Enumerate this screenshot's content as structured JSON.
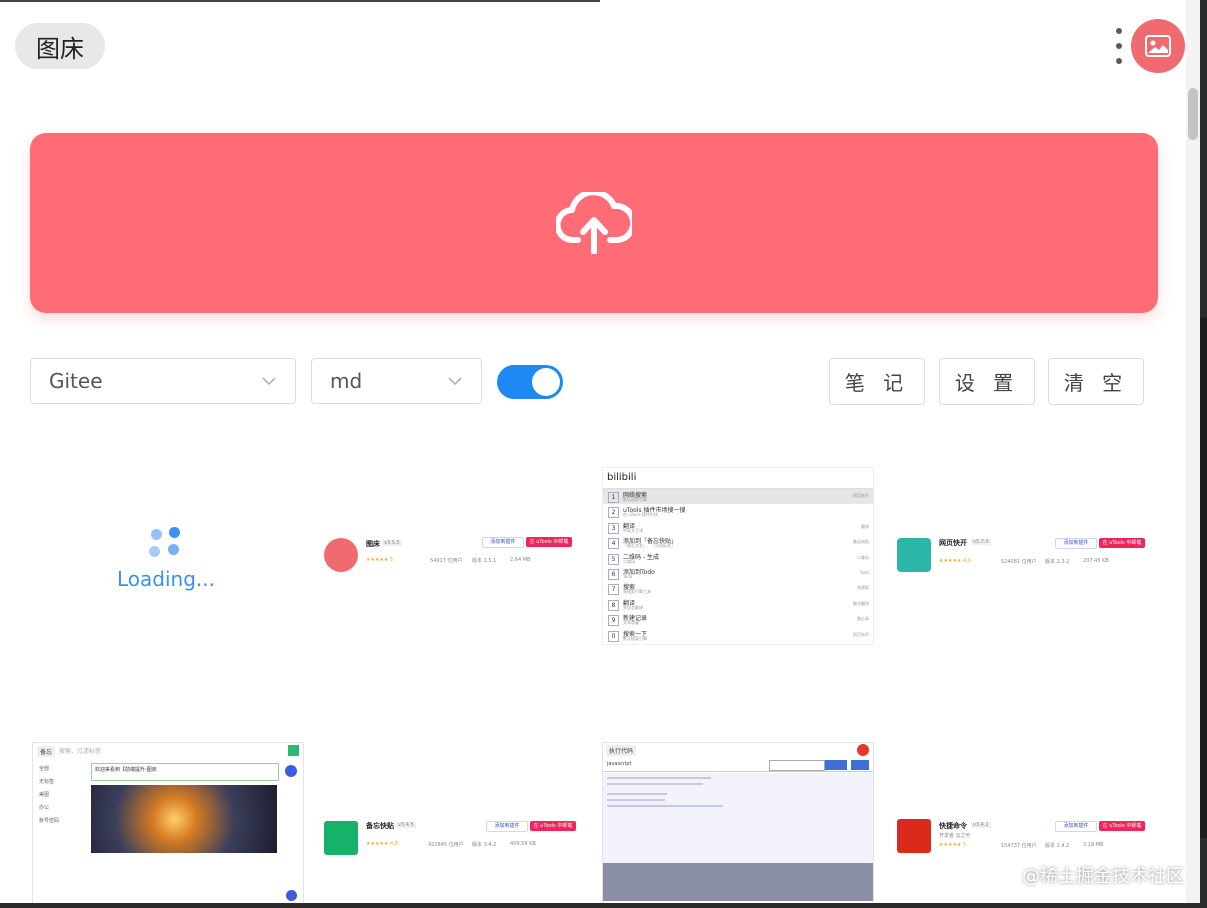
{
  "app": {
    "title": "图床"
  },
  "header": {
    "more_icon": "more-vertical-icon",
    "avatar_icon": "image-icon",
    "avatar_color": "#ef6b6f"
  },
  "upload": {
    "icon": "cloud-upload-icon",
    "color": "#ff6c76"
  },
  "toolbar": {
    "host_select": "Gitee",
    "format_select": "md",
    "toggle_on": true,
    "buttons": [
      "笔 记",
      "设 置",
      "清 空"
    ]
  },
  "loading": {
    "text": "Loading..."
  },
  "gallery": {
    "plugin1": {
      "name": "图床",
      "version": "v3.5.5",
      "rating": "5",
      "users": "54917 位用户",
      "ver_label": "版本 1.5.1",
      "size": "2.64 MB",
      "btn_installed": "添加到插件",
      "btn_uninstall": "在 uTools 中卸载"
    },
    "search": {
      "query": "bilibili",
      "items": [
        {
          "n": "1",
          "label": "网络搜索",
          "sub": "默认搜索引擎",
          "right": "网页快开"
        },
        {
          "n": "2",
          "label": "uTools 插件市场搜一搜",
          "sub": "在 uTools 插件市场",
          "right": ""
        },
        {
          "n": "3",
          "label": "翻译",
          "sub": "中英文互译",
          "right": "翻译"
        },
        {
          "n": "4",
          "label": "添加到「备忘快贴」",
          "sub": "「备忘文本」、「分组标签」",
          "right": "备忘快贴"
        },
        {
          "n": "5",
          "label": "二维码 - 生成",
          "sub": "二维码",
          "right": "二维码"
        },
        {
          "n": "6",
          "label": "添加到Todo",
          "sub": "Todo",
          "right": "Todo"
        },
        {
          "n": "7",
          "label": "搜索",
          "sub": "多搜索引擎工具",
          "right": "多搜索"
        },
        {
          "n": "8",
          "label": "翻译",
          "sub": "多语言翻译",
          "right": "聚合翻译"
        },
        {
          "n": "9",
          "label": "新建记录",
          "sub": "文本收藏",
          "right": "备忘录"
        },
        {
          "n": "0",
          "label": "搜索一下",
          "sub": "默认搜索引擎",
          "right": "网页快开"
        }
      ]
    },
    "plugin2": {
      "name": "网页快开",
      "version": "v5.7.0",
      "rating": "4.9",
      "users": "524081 位用户",
      "ver_label": "版本 2.3.2",
      "size": "207.45 KB",
      "btn_installed": "添加到插件",
      "btn_uninstall": "在 uTools 中卸载"
    },
    "note": {
      "search_placeholder": "搜索、过滤标签",
      "tag": "备忘",
      "sidebar": [
        "全部",
        "无标签",
        "美图",
        "办公",
        "账号密码"
      ],
      "text": "欢迎来看到【前端提升-图床"
    },
    "plugin3": {
      "name": "备忘快贴",
      "version": "v3.4.5",
      "rating": "4.8",
      "users": "422845 位用户",
      "ver_label": "版本 3.4.2",
      "size": "409.59 KB",
      "btn_installed": "添加到插件",
      "btn_uninstall": "在 uTools 中卸载"
    },
    "code": {
      "title": "执行代码",
      "lang": "javascript"
    },
    "plugin4": {
      "name": "快捷命令",
      "version": "v3.4.2",
      "author": "开发者 云之叶",
      "rating": "5",
      "users": "154737 位用户",
      "ver_label": "版本 2.4.2",
      "size": "3.18 MB",
      "btn_installed": "添加到插件",
      "btn_uninstall": "在 uTools 中卸载"
    }
  },
  "watermark": "@稀土掘金技术社区"
}
